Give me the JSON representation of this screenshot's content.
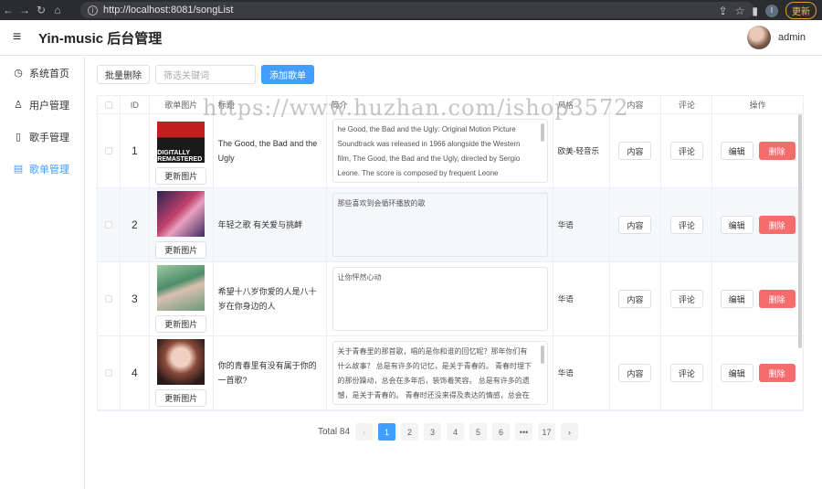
{
  "browser": {
    "url": "http://localhost:8081/songList",
    "update_label": "更新",
    "profile_initial": "I"
  },
  "header": {
    "title": "Yin-music 后台管理",
    "username": "admin"
  },
  "sidebar": {
    "items": [
      {
        "label": "系统首页",
        "icon": "clock-icon"
      },
      {
        "label": "用户管理",
        "icon": "user-icon"
      },
      {
        "label": "歌手管理",
        "icon": "phone-icon"
      },
      {
        "label": "歌单管理",
        "icon": "document-icon",
        "active": true
      }
    ]
  },
  "toolbar": {
    "batch_delete": "批量删除",
    "search_placeholder": "筛选关键词",
    "add": "添加歌单"
  },
  "table": {
    "headers": [
      "",
      "ID",
      "歌单图片",
      "标题",
      "简介",
      "风格",
      "内容",
      "评论",
      "操作"
    ],
    "rows": [
      {
        "id": "1",
        "title": "The Good, the Bad and the Ugly",
        "intro": "he Good, the Bad and the Ugly: Original Motion Picture Soundtrack was released in 1966 alongside the Western film, The Good, the Bad and the Ugly, directed by Sergio Leone. The score is composed by frequent Leone collaborator Ennio Morricone, whose",
        "style": "欧美-轻音乐",
        "thumb_text": "DIGITALLY REMASTERED"
      },
      {
        "id": "2",
        "title": "年轻之歌 有关爱与挑衅",
        "intro": "那些喜欢到会循环播放的歌",
        "style": "华语",
        "thumb_text": ""
      },
      {
        "id": "3",
        "title": "希望十八岁你爱的人是八十岁在你身边的人",
        "intro": "让你怦然心动",
        "style": "华语",
        "thumb_text": ""
      },
      {
        "id": "4",
        "title": "你的青春里有没有属于你的一首歌?",
        "intro": "关于青春里的那首歌，唱的是你和谁的回忆呢？那年你们有什么故事？ 总是有许多的记忆，是关于青春的。 青春时埋下的那份躁动，总会在多年后，装饰着笑容。 总是有许多的遗憾，是关于青春的。 青春时还没来得及表达的情感，总会在多年以后，偶尔的左右着思",
        "style": "华语",
        "thumb_text": ""
      }
    ],
    "update_image": "更新图片",
    "content_btn": "内容",
    "comment_btn": "评论",
    "edit_btn": "编辑",
    "delete_btn": "删除"
  },
  "pagination": {
    "total": "Total 84",
    "pages": [
      "1",
      "2",
      "3",
      "4",
      "5",
      "6",
      "•••",
      "17"
    ],
    "current": "1"
  },
  "watermark": "https://www.huzhan.com/ishop3572",
  "colors": {
    "primary": "#409eff",
    "danger": "#f56c6c"
  }
}
